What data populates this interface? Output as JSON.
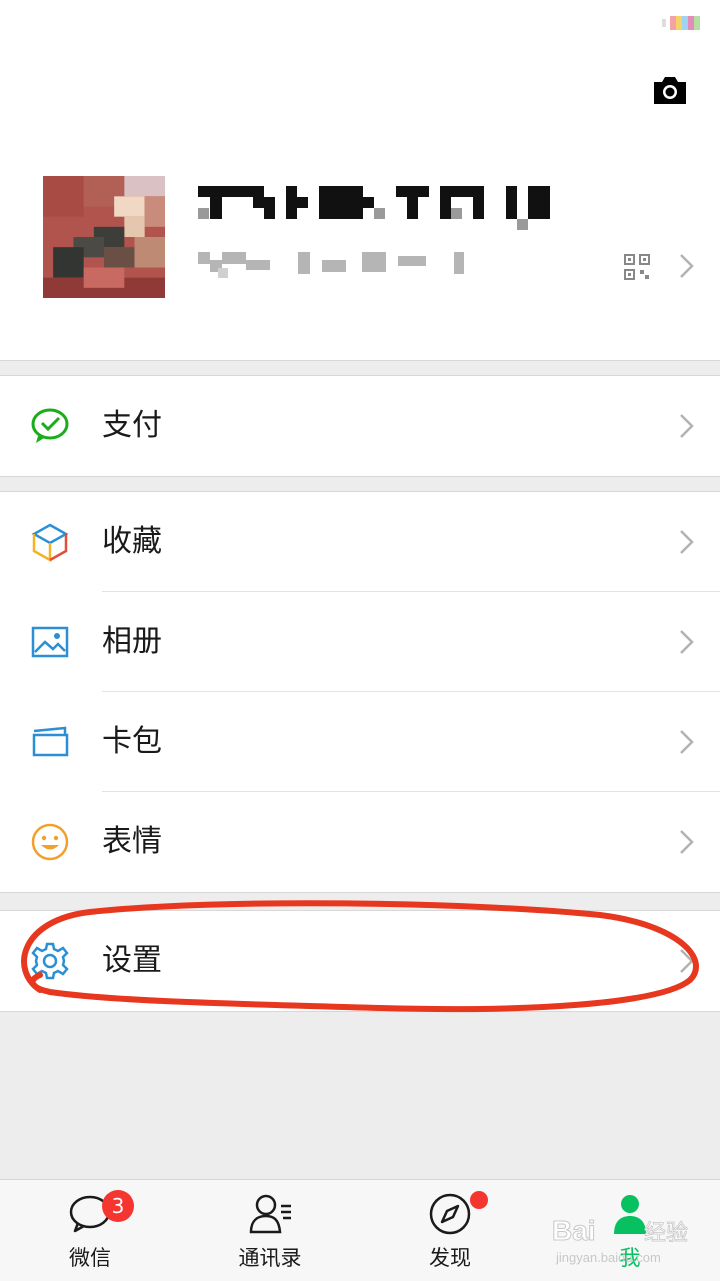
{
  "colors": {
    "accent": "#07c160",
    "badge": "#f43530",
    "annotation": "#e8371f"
  },
  "profile": {
    "name_text": "",
    "id_text": ""
  },
  "menu": {
    "pay": {
      "label": "支付",
      "icon": "wechat-pay-icon"
    },
    "favorites": {
      "label": "收藏",
      "icon": "favorites-cube-icon"
    },
    "album": {
      "label": "相册",
      "icon": "album-picture-icon"
    },
    "cards": {
      "label": "卡包",
      "icon": "card-wallet-icon"
    },
    "stickers": {
      "label": "表情",
      "icon": "smiley-icon"
    },
    "settings": {
      "label": "设置",
      "icon": "gear-icon"
    }
  },
  "tabbar": {
    "chats": {
      "label": "微信",
      "badge": "3",
      "icon": "chat-bubble-icon"
    },
    "contacts": {
      "label": "通讯录",
      "icon": "contacts-icon"
    },
    "discover": {
      "label": "发现",
      "icon": "compass-icon"
    },
    "me": {
      "label": "我",
      "icon": "person-icon",
      "active": true
    }
  },
  "watermark": {
    "brand": "Bai",
    "brand2": "经验",
    "url": "jingyan.baidu.com"
  }
}
